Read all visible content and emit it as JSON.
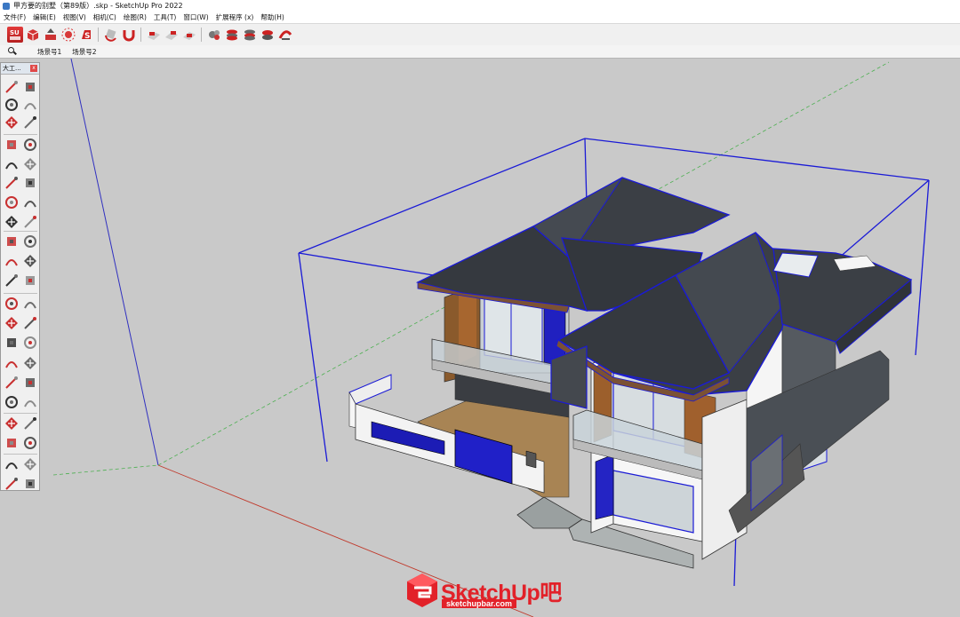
{
  "window": {
    "title": "甲方要的别墅（第89版）.skp - SketchUp Pro 2022"
  },
  "menu": [
    {
      "label": "文件(F)"
    },
    {
      "label": "编辑(E)"
    },
    {
      "label": "视图(V)"
    },
    {
      "label": "相机(C)"
    },
    {
      "label": "绘图(R)"
    },
    {
      "label": "工具(T)"
    },
    {
      "label": "窗口(W)"
    },
    {
      "label": "扩展程序 (x)"
    },
    {
      "label": "帮助(H)"
    }
  ],
  "toolbar_icons": [
    "su-logo-icon",
    "box-icon",
    "push-pull-icon",
    "sun-icon",
    "ruby-icon",
    "rotate-icon",
    "magnet-icon",
    "stack-1-icon",
    "stack-2-icon",
    "stack-3-icon",
    "settings-icon",
    "layer-1-icon",
    "layer-2-icon",
    "layer-3-icon",
    "sweep-icon"
  ],
  "scenes": {
    "tab1": "场景号1",
    "tab2": "场景号2"
  },
  "tool_palette": {
    "title": "大工...",
    "close": "x",
    "tools": [
      "select-icon",
      "orbit-icon",
      "paint-icon",
      "eraser-icon",
      "component-icon",
      "tag-icon",
      "line-icon",
      "freehand-icon",
      "rectangle-icon",
      "rotated-rect-icon",
      "circle-icon",
      "polygon-icon",
      "arc-icon",
      "arc-2-icon",
      "pie-icon",
      "arc-3-icon",
      "move-icon",
      "push-pull-icon",
      "rotate-icon",
      "follow-me-icon",
      "scale-icon",
      "offset-icon",
      "tape-measure-icon",
      "dimension-icon",
      "protractor-icon",
      "text-icon",
      "axes-icon",
      "3d-text-icon",
      "orbit-2-icon",
      "pan-icon",
      "zoom-icon",
      "zoom-window-icon",
      "zoom-extents-icon",
      "previous-view-icon",
      "position-camera-icon",
      "look-around-icon",
      "walk-icon",
      "section-plane-icon",
      "sandbox-1-icon",
      "sandbox-2-icon",
      "sandbox-3-icon",
      "sandbox-4-icon"
    ]
  },
  "watermark": {
    "brand": "SketchUp吧",
    "url": "sketchupbar.com"
  },
  "colors": {
    "axis_red": "#c0392b",
    "axis_green": "#4caf50",
    "axis_blue": "#3030c0",
    "selection": "#1a1ad6",
    "roof": "#3b3f45",
    "wall": "#f4f4f4",
    "wood": "#a0562a",
    "brand_red": "#e22129"
  }
}
